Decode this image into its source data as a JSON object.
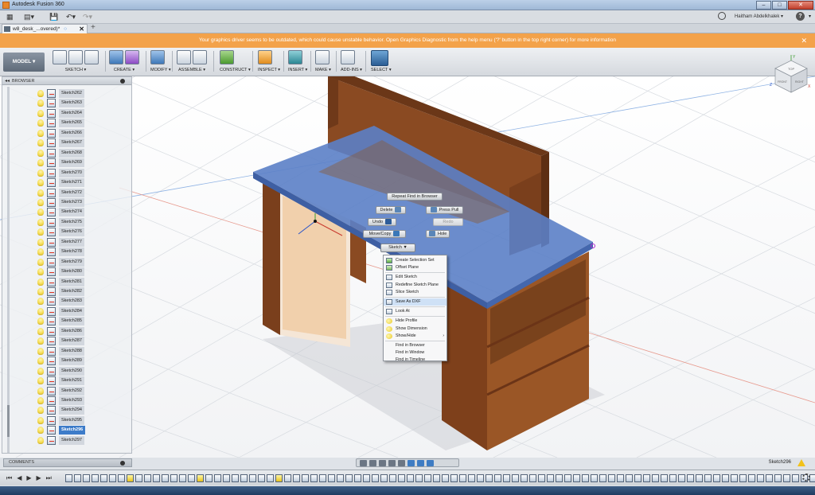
{
  "window": {
    "title": "Autodesk Fusion 360",
    "min": "–",
    "max": "□",
    "close": "✕"
  },
  "qat": {
    "user": "Haitham Abdelkhalek ▾"
  },
  "tab": {
    "name": "w8_desk_...overed)",
    "modified": "*",
    "close": "✕",
    "new": "+"
  },
  "warning": {
    "text": "Your graphics driver seems to be outdated, which could cause unstable behavior. Open Graphics Diagnostic from the help menu ('?' button in the top right corner) for more information",
    "close": "✕"
  },
  "toolbar": {
    "workspace": "MODEL ▾",
    "groups": [
      "SKETCH ▾",
      "CREATE ▾",
      "MODIFY ▾",
      "ASSEMBLE ▾",
      "CONSTRUCT ▾",
      "INSPECT ▾",
      "INSERT ▾",
      "MAKE ▾",
      "ADD-INS ▾",
      "SELECT ▾"
    ]
  },
  "browser": {
    "title": "BROWSER",
    "items": [
      "Sketch262",
      "Sketch263",
      "Sketch264",
      "Sketch265",
      "Sketch266",
      "Sketch267",
      "Sketch268",
      "Sketch269",
      "Sketch270",
      "Sketch271",
      "Sketch272",
      "Sketch273",
      "Sketch274",
      "Sketch275",
      "Sketch276",
      "Sketch277",
      "Sketch278",
      "Sketch279",
      "Sketch280",
      "Sketch281",
      "Sketch282",
      "Sketch283",
      "Sketch284",
      "Sketch285",
      "Sketch286",
      "Sketch287",
      "Sketch288",
      "Sketch289",
      "Sketch290",
      "Sketch291",
      "Sketch292",
      "Sketch293",
      "Sketch294",
      "Sketch295",
      "Sketch296",
      "Sketch297"
    ],
    "selected": "Sketch296"
  },
  "comments": {
    "label": "COMMENTS"
  },
  "marking_menu": {
    "repeat": "Repeat Find in Browser",
    "delete": "Delete",
    "press_pull": "Press Pull",
    "undo": "Undo",
    "redo": "Redo",
    "move_copy": "Move/Copy",
    "hole": "Hole",
    "sketch": "Sketch ▼"
  },
  "context_menu": {
    "items": [
      "Create Selection Set",
      "Offset Plane",
      "Edit Sketch",
      "Redefine Sketch Plane",
      "Slice Sketch",
      "Save As DXF",
      "Look At",
      "Hide Profile",
      "Show Dimension",
      "Show/Hide",
      "Find in Browser",
      "Find in Window",
      "Find in Timeline"
    ],
    "submenu_arrow": "›"
  },
  "viewcube": {
    "top": "TOP",
    "front": "FRONT",
    "right": "RIGHT",
    "axis_x": "X",
    "axis_y": "Y",
    "axis_z": "Z"
  },
  "status": {
    "selection": "Sketch296"
  },
  "timeline": {
    "controls": [
      "⏮",
      "◀",
      "▶",
      "▶",
      "⏭"
    ]
  },
  "colors": {
    "warning_bg": "#f3a24a",
    "selected_blue": "#3d7cc9",
    "wood": "#8a4a22",
    "selected_face": "#5b7fc7"
  }
}
